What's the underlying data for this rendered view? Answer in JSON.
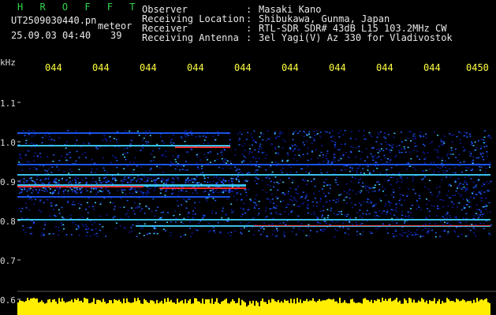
{
  "header": {
    "app_name": "H R O F F T",
    "filename": "UT2509030440.pn",
    "mode": "meteor",
    "datetime": "25.09.03 04:40",
    "count": "39",
    "fields": [
      {
        "label": "Observer",
        "value": "Masaki Kano"
      },
      {
        "label": "Receiving Location",
        "value": "Shibukawa, Gunma, Japan"
      },
      {
        "label": "Receiver",
        "value": "RTL-SDR SDR# 43dB L15 103.2MHz CW"
      },
      {
        "label": "Receiving Antenna",
        "value": "3el Yagi(V) Az 330 for Vladivostok"
      }
    ],
    "separator": ":"
  },
  "axes": {
    "y_unit": "kHz",
    "y_ticks": [
      "1.1",
      "1.0",
      "0.9",
      "0.8",
      "0.7",
      "0.6"
    ],
    "x_ticks": [
      "044",
      "044",
      "044",
      "044",
      "044",
      "044",
      "044",
      "044",
      "044",
      "0450"
    ]
  },
  "colors": {
    "background": "#000000",
    "header_title": "#31d64a",
    "tick_labels": "#ffff40",
    "axis_text": "#d8d8d8",
    "noise_low": "#0a1a9a",
    "noise_mid": "#1e5cff",
    "noise_high": "#3fd4ff",
    "signal": "#ff3030",
    "level_bar": "#ffee00"
  }
}
